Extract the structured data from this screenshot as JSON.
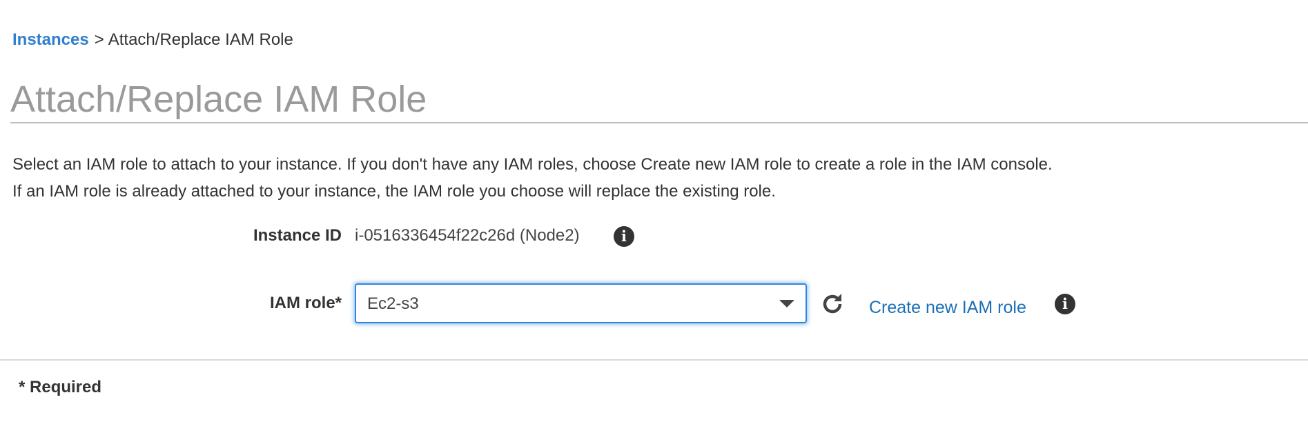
{
  "breadcrumb": {
    "link_label": "Instances",
    "separator": ">",
    "current_label": "Attach/Replace IAM Role"
  },
  "page": {
    "title": "Attach/Replace IAM Role",
    "description_line1": "Select an IAM role to attach to your instance. If you don't have any IAM roles, choose Create new IAM role to create a role in the IAM console.",
    "description_line2": "If an IAM role is already attached to your instance, the IAM role you choose will replace the existing role."
  },
  "form": {
    "instance_id_label": "Instance ID",
    "instance_id_value": "i-0516336454f22c26d (Node2)",
    "iam_role_label": "IAM role*",
    "iam_role_selected": "Ec2-s3",
    "create_link_label": "Create new IAM role"
  },
  "footer": {
    "required_note": "* Required"
  },
  "icons": {
    "info": "info-icon",
    "refresh": "refresh-icon",
    "dropdown_caret": "chevron-down-icon"
  },
  "colors": {
    "link": "#2f7fd0",
    "select_focus": "#2e86de",
    "title": "#9a9a9a",
    "text": "#333333"
  }
}
